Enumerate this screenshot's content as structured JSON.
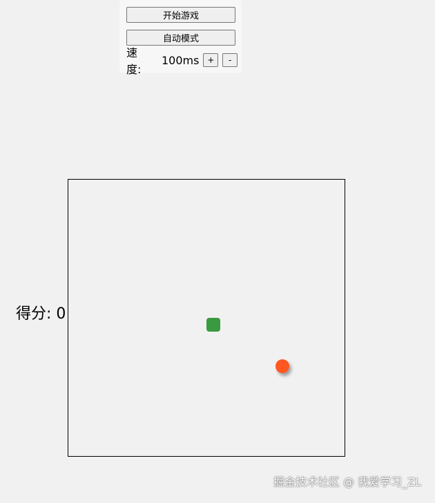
{
  "controls": {
    "start_label": "开始游戏",
    "auto_label": "自动模式",
    "speed_label": "速度:",
    "speed_value": "100ms",
    "increase_label": "+",
    "decrease_label": "-"
  },
  "score": {
    "text": "得分: 0"
  },
  "board": {
    "snake_color": "#3a9a40",
    "food_color": "#ff5722",
    "background": "#f1f1f1"
  },
  "watermark": {
    "text": "掘金技术社区 @ 我爱学习_ZL"
  }
}
